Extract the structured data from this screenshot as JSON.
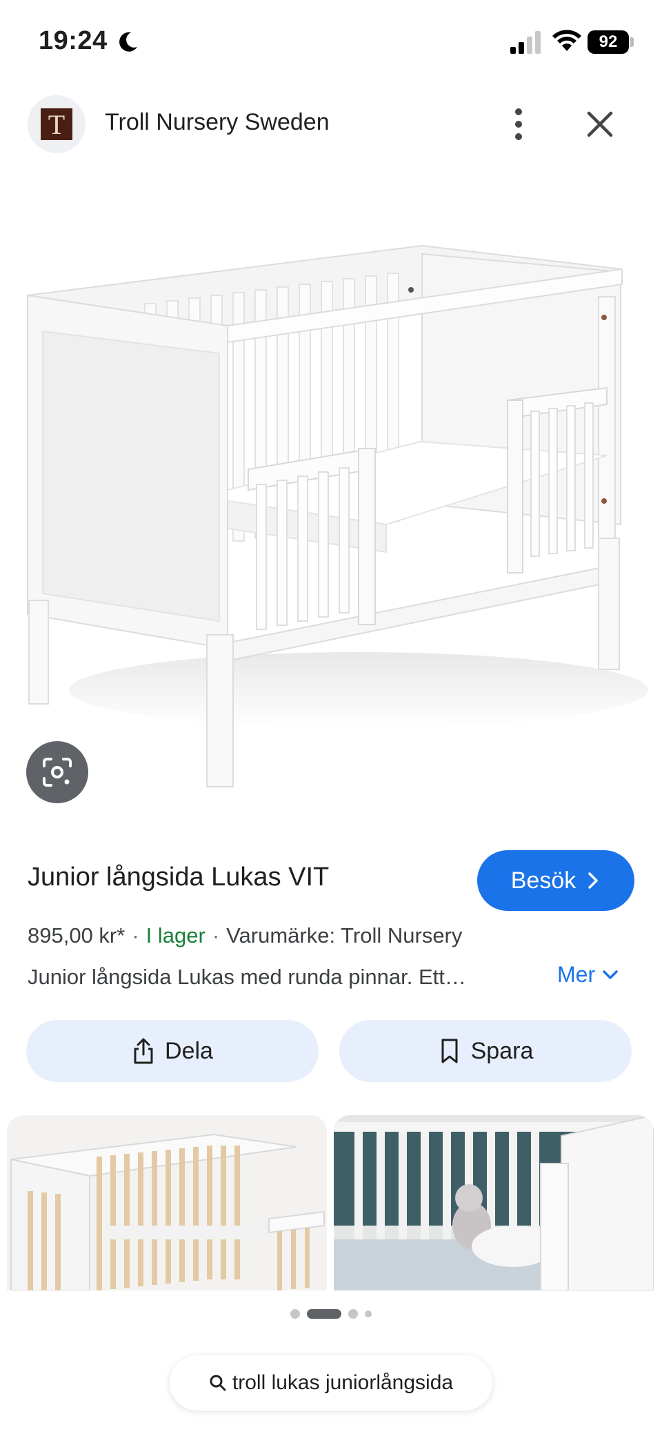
{
  "status_bar": {
    "time": "19:24",
    "battery": "92"
  },
  "header": {
    "site_logo_letter": "T",
    "site_name": "Troll Nursery Sweden"
  },
  "product": {
    "title": "Junior långsida Lukas VIT",
    "visit_label": "Besök",
    "price": "895,00 kr*",
    "stock": "I lager",
    "brand": "Varumärke: Troll Nursery",
    "description": "Junior långsida Lukas med runda pinnar. Ett…",
    "more_label": "Mer"
  },
  "actions": {
    "share_label": "Dela",
    "save_label": "Spara"
  },
  "search": {
    "query": "troll lukas juniorlångsida"
  },
  "colors": {
    "accent": "#1a73e8",
    "in_stock": "#188038",
    "action_bg": "#e8effc"
  },
  "icons": [
    "moon-icon",
    "signal-icon",
    "wifi-icon",
    "more-vert-icon",
    "close-icon",
    "lens-icon",
    "chevron-right-icon",
    "chevron-down-icon",
    "share-icon",
    "bookmark-icon",
    "search-icon"
  ],
  "pager": {
    "count": 4,
    "active_index": 1
  }
}
